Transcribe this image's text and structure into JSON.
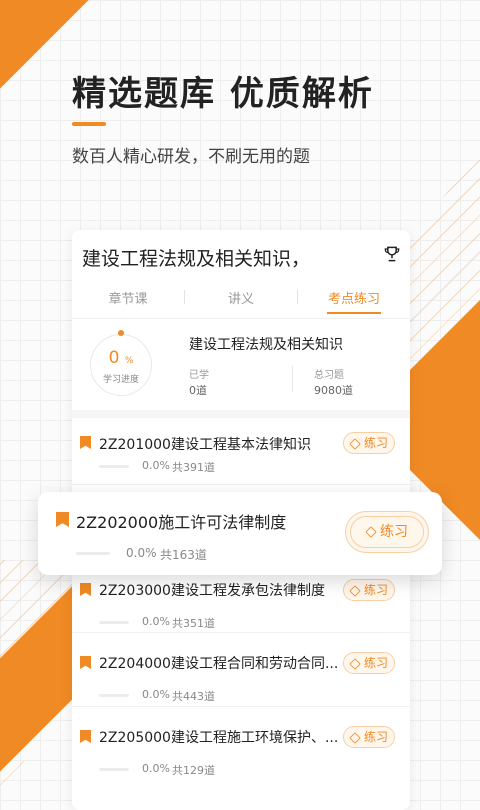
{
  "headline": "精选题库 优质解析",
  "subline": "数百人精心研发，不刷无用的题",
  "course": {
    "title": "建设工程法规及相关知识，"
  },
  "tabs": [
    {
      "label": "章节课",
      "active": false
    },
    {
      "label": "讲义",
      "active": false
    },
    {
      "label": "考点练习",
      "active": true
    }
  ],
  "summary": {
    "progress_value": "0",
    "progress_unit": "%",
    "progress_label": "学习进度",
    "title": "建设工程法规及相关知识",
    "learned_label": "已学",
    "learned_value": "0道",
    "total_label": "总习题",
    "total_value": "9080道"
  },
  "practice_label": "练习",
  "items": [
    {
      "title": "2Z201000建设工程基本法律知识",
      "progress": "0.0%",
      "count": "共391道"
    },
    {
      "title": "2Z202000施工许可法律制度",
      "progress": "0.0%",
      "count": "共163道"
    },
    {
      "title": "2Z203000建设工程发承包法律制度",
      "progress": "0.0%",
      "count": "共351道"
    },
    {
      "title": "2Z204000建设工程合同和劳动合同...",
      "progress": "0.0%",
      "count": "共443道"
    },
    {
      "title": "2Z205000建设工程施工环境保护、...",
      "progress": "0.0%",
      "count": "共129道"
    }
  ],
  "colors": {
    "accent": "#f08a24",
    "text": "#222222"
  },
  "icons": {
    "trophy": "trophy-icon",
    "bookmark": "bookmark-icon",
    "pencil": "pencil-icon"
  }
}
